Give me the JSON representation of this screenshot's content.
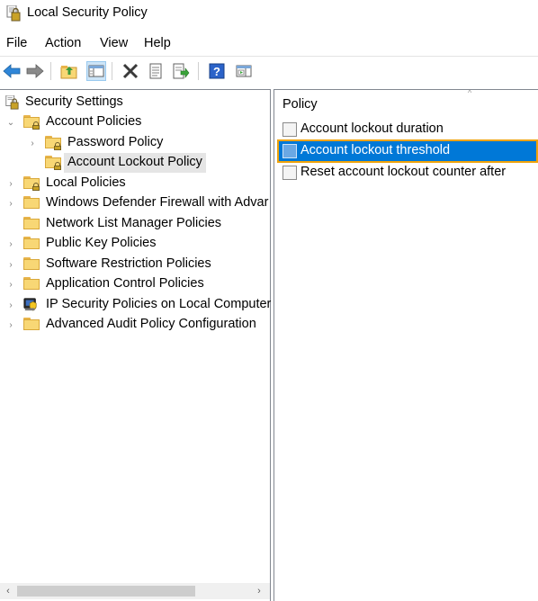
{
  "window": {
    "title": "Local Security Policy",
    "icon": "local-security-policy-icon"
  },
  "menubar": {
    "items": [
      "File",
      "Action",
      "View",
      "Help"
    ]
  },
  "toolbar": {
    "buttons": [
      {
        "name": "back-button",
        "icon": "back-arrow-icon"
      },
      {
        "name": "forward-button",
        "icon": "forward-arrow-icon"
      },
      {
        "name": "up-one-level-button",
        "icon": "folder-up-icon"
      },
      {
        "name": "show-hide-console-tree-button",
        "icon": "console-tree-icon",
        "active": true
      },
      {
        "name": "delete-button",
        "icon": "delete-x-icon"
      },
      {
        "name": "properties-button",
        "icon": "properties-icon"
      },
      {
        "name": "export-list-button",
        "icon": "export-list-icon"
      },
      {
        "name": "help-button",
        "icon": "help-icon"
      },
      {
        "name": "show-hide-action-pane-button",
        "icon": "action-pane-icon"
      }
    ]
  },
  "tree": {
    "root": "Security Settings",
    "items": [
      {
        "label": "Account Policies",
        "expanded": true,
        "level": 1
      },
      {
        "label": "Password Policy",
        "expanded": false,
        "level": 2
      },
      {
        "label": "Account Lockout Policy",
        "selected": true,
        "level": 2
      },
      {
        "label": "Local Policies",
        "level": 1
      },
      {
        "label": "Windows Defender Firewall with Advar",
        "level": 1
      },
      {
        "label": "Network List Manager Policies",
        "level": 1
      },
      {
        "label": "Public Key Policies",
        "level": 1
      },
      {
        "label": "Software Restriction Policies",
        "level": 1
      },
      {
        "label": "Application Control Policies",
        "level": 1
      },
      {
        "label": "IP Security Policies on Local Computer",
        "level": 1
      },
      {
        "label": "Advanced Audit Policy Configuration",
        "level": 1
      }
    ]
  },
  "list": {
    "column_header": "Policy",
    "rows": [
      {
        "label": "Account lockout duration"
      },
      {
        "label": "Account lockout threshold",
        "selected": true
      },
      {
        "label": "Reset account lockout counter after"
      }
    ]
  },
  "colors": {
    "selection_blue": "#0078d7",
    "selection_outline": "#f0a30a",
    "tree_selected_bg": "#e5e5e5",
    "folder_yellow": "#f8d775"
  }
}
